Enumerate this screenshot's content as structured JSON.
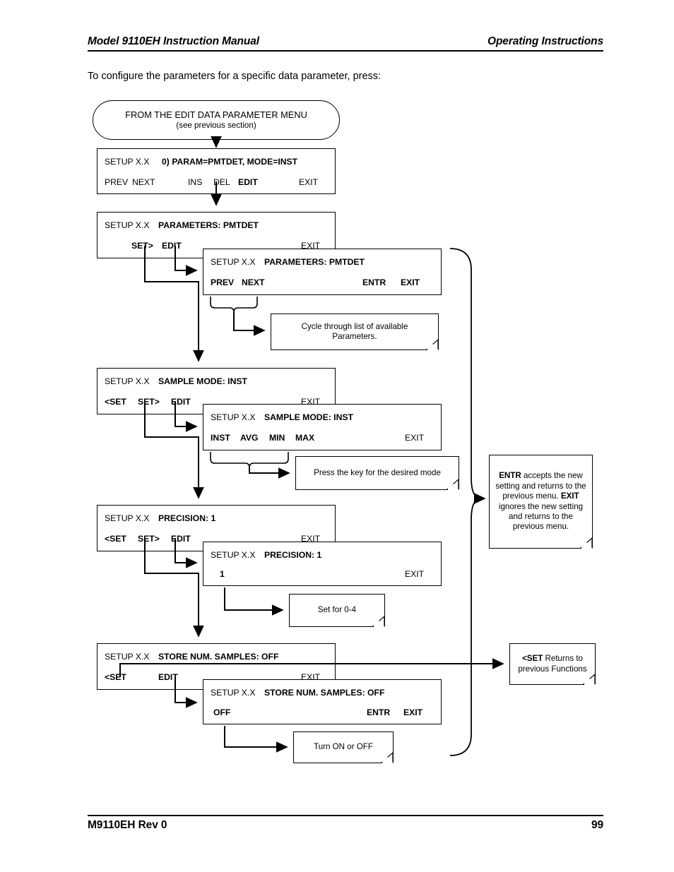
{
  "header": {
    "left": "Model 9110EH Instruction Manual",
    "right": "Operating Instructions"
  },
  "footer": {
    "left": "M9110EH Rev 0",
    "right": "99"
  },
  "intro": "To configure the parameters for a specific data parameter, press:",
  "start": {
    "line1": "FROM THE EDIT DATA PARAMETER  MENU",
    "line2": "(see previous section)"
  },
  "panels": {
    "param": {
      "setup": "SETUP X.X",
      "title": "0) PARAM=PMTDET, MODE=INST",
      "prev": "PREV",
      "next": "NEXT",
      "ins": "INS",
      "del": "DEL",
      "edit": "EDIT",
      "exit": "EXIT"
    },
    "parameters_main": {
      "setup": "SETUP X.X",
      "title": "PARAMETERS: PMTDET",
      "setfwd": "SET>",
      "edit": "EDIT",
      "exit": "EXIT"
    },
    "parameters_sub": {
      "setup": "SETUP X.X",
      "title": "PARAMETERS: PMTDET",
      "prev": "PREV",
      "next": "NEXT",
      "entr": "ENTR",
      "exit": "EXIT"
    },
    "samplemode_main": {
      "setup": "SETUP X.X",
      "title": "SAMPLE MODE: INST",
      "setback": "<SET",
      "setfwd": "SET>",
      "edit": "EDIT",
      "exit": "EXIT"
    },
    "samplemode_sub": {
      "setup": "SETUP X.X",
      "title": "SAMPLE MODE: INST",
      "inst": "INST",
      "avg": "AVG",
      "min": "MIN",
      "max": "MAX",
      "exit": "EXIT"
    },
    "precision_main": {
      "setup": "SETUP X.X",
      "title": "PRECISION: 1",
      "setback": "<SET",
      "setfwd": "SET>",
      "edit": "EDIT",
      "exit": "EXIT"
    },
    "precision_sub": {
      "setup": "SETUP X.X",
      "title": "PRECISION: 1",
      "value": "1",
      "exit": "EXIT"
    },
    "store_main": {
      "setup": "SETUP X.X",
      "title": "STORE NUM. SAMPLES: OFF",
      "setback": "<SET",
      "edit": "EDIT",
      "exit": "EXIT"
    },
    "store_sub": {
      "setup": "SETUP X.X",
      "title": "STORE NUM. SAMPLES: OFF",
      "off": "OFF",
      "entr": "ENTR",
      "exit": "EXIT"
    }
  },
  "notes": {
    "cycle": {
      "line1": "Cycle through list of available",
      "line2": "Parameters."
    },
    "presskey": {
      "line1": "Press the key for the desired mode"
    },
    "setfor": {
      "line1": "Set for 0-4"
    },
    "turnonoff": {
      "line1": "Turn ON or OFF"
    },
    "entrexit": {
      "b1": "ENTR",
      "t1": " accepts the new setting and returns to the previous menu.",
      "b2": "EXIT",
      "t2": " ignores the new setting and returns to the previous menu."
    },
    "setreturns": {
      "b1": "<SET",
      "t1": " Returns to previous Functions"
    }
  }
}
